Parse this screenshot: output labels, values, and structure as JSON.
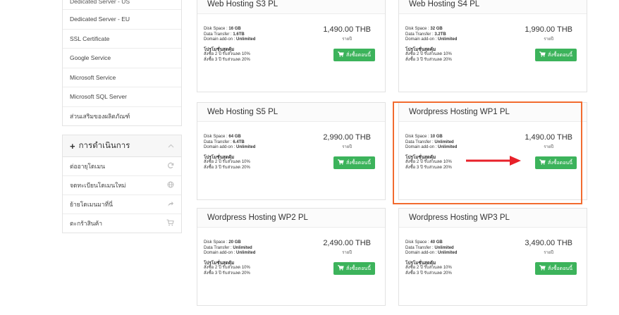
{
  "sidebar": {
    "categories": [
      "Dedicated Server - US",
      "Dedicated Server - EU",
      "SSL Certificate",
      "Google Service",
      "Microsoft Service",
      "Microsoft SQL Server",
      "ส่วนเสริมของผลิตภัณฑ์"
    ],
    "actions_title": "การดำเนินการ",
    "actions": [
      {
        "label": "ต่ออายุโดเมน",
        "icon": "refresh-icon"
      },
      {
        "label": "จดทะเบียนโดเมนใหม่",
        "icon": "globe-icon"
      },
      {
        "label": "ย้ายโดเมนมาที่นี่",
        "icon": "share-icon"
      },
      {
        "label": "ตะกร้าสินค้า",
        "icon": "cart-icon"
      }
    ]
  },
  "common": {
    "disk_label": "Disk Space : ",
    "transfer_label": "Data Transfer : ",
    "addon_label": "Domain add-on : ",
    "addon_value": "Unlimited",
    "promo_title": "โปรโมชั่นสุดคุ้ม",
    "promo_line1": "สั่งซื้อ 2 ปี รับส่วนลด 10%",
    "promo_line2": "สั่งซื้อ 3 ปี รับส่วนลด 20%",
    "per_year": "รายปี",
    "order_label": "สั่งซื้อตอนนี้"
  },
  "products": [
    {
      "title": "Web Hosting S3 PL",
      "disk": "16 GB",
      "transfer": "1.6TB",
      "price": "1,490.00 THB"
    },
    {
      "title": "Web Hosting S4 PL",
      "disk": "32 GB",
      "transfer": "3.2TB",
      "price": "1,990.00 THB"
    },
    {
      "title": "Web Hosting S5 PL",
      "disk": "64 GB",
      "transfer": "6.4TB",
      "price": "2,990.00 THB"
    },
    {
      "title": "Wordpress Hosting WP1 PL",
      "disk": "10 GB",
      "transfer": "Unlimited",
      "price": "1,490.00 THB"
    },
    {
      "title": "Wordpress Hosting WP2 PL",
      "disk": "20 GB",
      "transfer": "Unlimited",
      "price": "2,490.00 THB"
    },
    {
      "title": "Wordpress Hosting WP3 PL",
      "disk": "40 GB",
      "transfer": "Unlimited",
      "price": "3,490.00 THB"
    }
  ],
  "colors": {
    "order_button": "#3cb35b",
    "highlight_box": "#f26b2f",
    "arrow": "#e8212a"
  }
}
